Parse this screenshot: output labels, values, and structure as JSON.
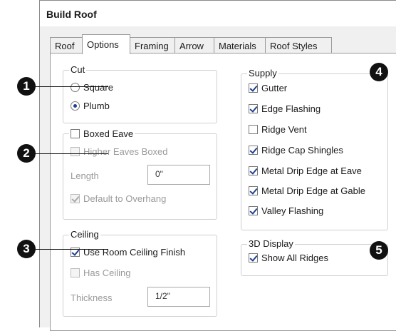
{
  "window": {
    "title": "Build Roof"
  },
  "tabs": [
    {
      "label": "Roof",
      "active": false
    },
    {
      "label": "Options",
      "active": true
    },
    {
      "label": "Framing",
      "active": false
    },
    {
      "label": "Arrow",
      "active": false
    },
    {
      "label": "Materials",
      "active": false
    },
    {
      "label": "Roof Styles",
      "active": false
    }
  ],
  "cut": {
    "legend": "Cut",
    "options": [
      {
        "label": "Square",
        "checked": false
      },
      {
        "label": "Plumb",
        "checked": true
      }
    ]
  },
  "eave": {
    "boxed_eave_label": "Boxed Eave",
    "higher_eaves_label": "Higher Eaves Boxed",
    "length_label": "Length",
    "length_value": "0\"",
    "default_overhang_label": "Default to Overhang"
  },
  "ceiling": {
    "legend": "Ceiling",
    "use_room_label": "Use Room Ceiling Finish",
    "has_ceiling_label": "Has Ceiling",
    "thickness_label": "Thickness",
    "thickness_value": "1/2\""
  },
  "supply": {
    "legend": "Supply",
    "items": [
      {
        "label": "Gutter",
        "checked": true
      },
      {
        "label": "Edge Flashing",
        "checked": true
      },
      {
        "label": "Ridge Vent",
        "checked": false
      },
      {
        "label": "Ridge Cap Shingles",
        "checked": true
      },
      {
        "label": "Metal Drip Edge at Eave",
        "checked": true
      },
      {
        "label": "Metal Drip Edge at Gable",
        "checked": true
      },
      {
        "label": "Valley Flashing",
        "checked": true
      }
    ]
  },
  "display3d": {
    "legend": "3D Display",
    "show_ridges_label": "Show All Ridges"
  },
  "callouts": [
    "1",
    "2",
    "3",
    "4",
    "5"
  ]
}
